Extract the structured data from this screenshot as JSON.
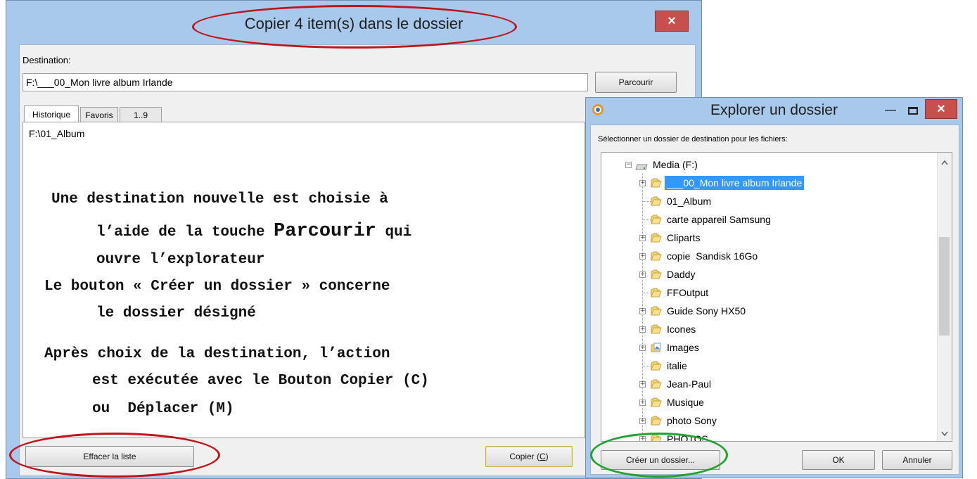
{
  "colors": {
    "title_bar": "#a9c9ec",
    "close_red": "#c7504f",
    "selection_blue": "#3399ff",
    "annotation_red_circle": "#c0141b",
    "annotation_green_circle": "#21a330"
  },
  "copy_dialog": {
    "title": "Copier 4 item(s) dans le dossier",
    "close_glyph": "×",
    "destination_label": "Destination:",
    "destination_value": "F:\\___00_Mon livre album Irlande",
    "browse_button": "Parcourir",
    "tabs": [
      "Historique",
      "Favoris",
      "1..9"
    ],
    "history_items": [
      "F:\\01_Album"
    ],
    "clear_button": "Effacer la liste",
    "copy_button_prefix": "Copier (",
    "copy_button_key": "C",
    "copy_button_suffix": ")"
  },
  "annotation": {
    "lines": [
      [
        {
          "t": "Une destination nouvelle est choisie à"
        }
      ],
      [
        {
          "t": "l’aide de la touche "
        },
        {
          "t": "Parcourir",
          "big": true
        },
        {
          "t": " qui"
        }
      ],
      [
        {
          "t": "ouvre l’explorateur"
        }
      ],
      [
        {
          "t": "Le bouton « Créer un dossier » concerne"
        }
      ],
      [
        {
          "t": "le dossier désigné"
        }
      ],
      [
        {
          "t": "Après choix de la destination, l’action"
        }
      ],
      [
        {
          "t": "est exécutée avec le Bouton Copier (C)"
        }
      ],
      [
        {
          "t": "ou  Déplacer (M)"
        }
      ]
    ]
  },
  "explorer_dialog": {
    "title": "Explorer un dossier",
    "minimize_glyph": "—",
    "close_glyph": "×",
    "prompt": "Sélectionner un dossier de destination pour les fichiers:",
    "root": "Media (F:)",
    "items": [
      {
        "label": "___00_Mon livre album Irlande",
        "expand": true,
        "selected": true,
        "icon": "folder-icon"
      },
      {
        "label": "01_Album",
        "expand": false,
        "icon": "folder-icon"
      },
      {
        "label": "carte appareil Samsung",
        "expand": false,
        "icon": "folder-icon"
      },
      {
        "label": "Cliparts",
        "expand": true,
        "icon": "folder-icon"
      },
      {
        "label": "copie  Sandisk 16Go",
        "expand": true,
        "icon": "folder-icon"
      },
      {
        "label": "Daddy",
        "expand": true,
        "icon": "folder-icon"
      },
      {
        "label": "FFOutput",
        "expand": false,
        "icon": "folder-icon"
      },
      {
        "label": "Guide Sony HX50",
        "expand": true,
        "icon": "folder-icon"
      },
      {
        "label": "Icones",
        "expand": true,
        "icon": "folder-icon"
      },
      {
        "label": "Images",
        "expand": true,
        "icon": "pictures-folder-icon"
      },
      {
        "label": "italie",
        "expand": false,
        "icon": "folder-icon"
      },
      {
        "label": "Jean-Paul",
        "expand": true,
        "icon": "folder-icon"
      },
      {
        "label": "Musique",
        "expand": true,
        "icon": "folder-icon"
      },
      {
        "label": "photo Sony",
        "expand": true,
        "icon": "folder-icon"
      },
      {
        "label": "PHOTOS",
        "expand": true,
        "icon": "folder-icon"
      }
    ],
    "create_folder_button": "Créer un dossier...",
    "ok_button": "OK",
    "cancel_button": "Annuler"
  }
}
